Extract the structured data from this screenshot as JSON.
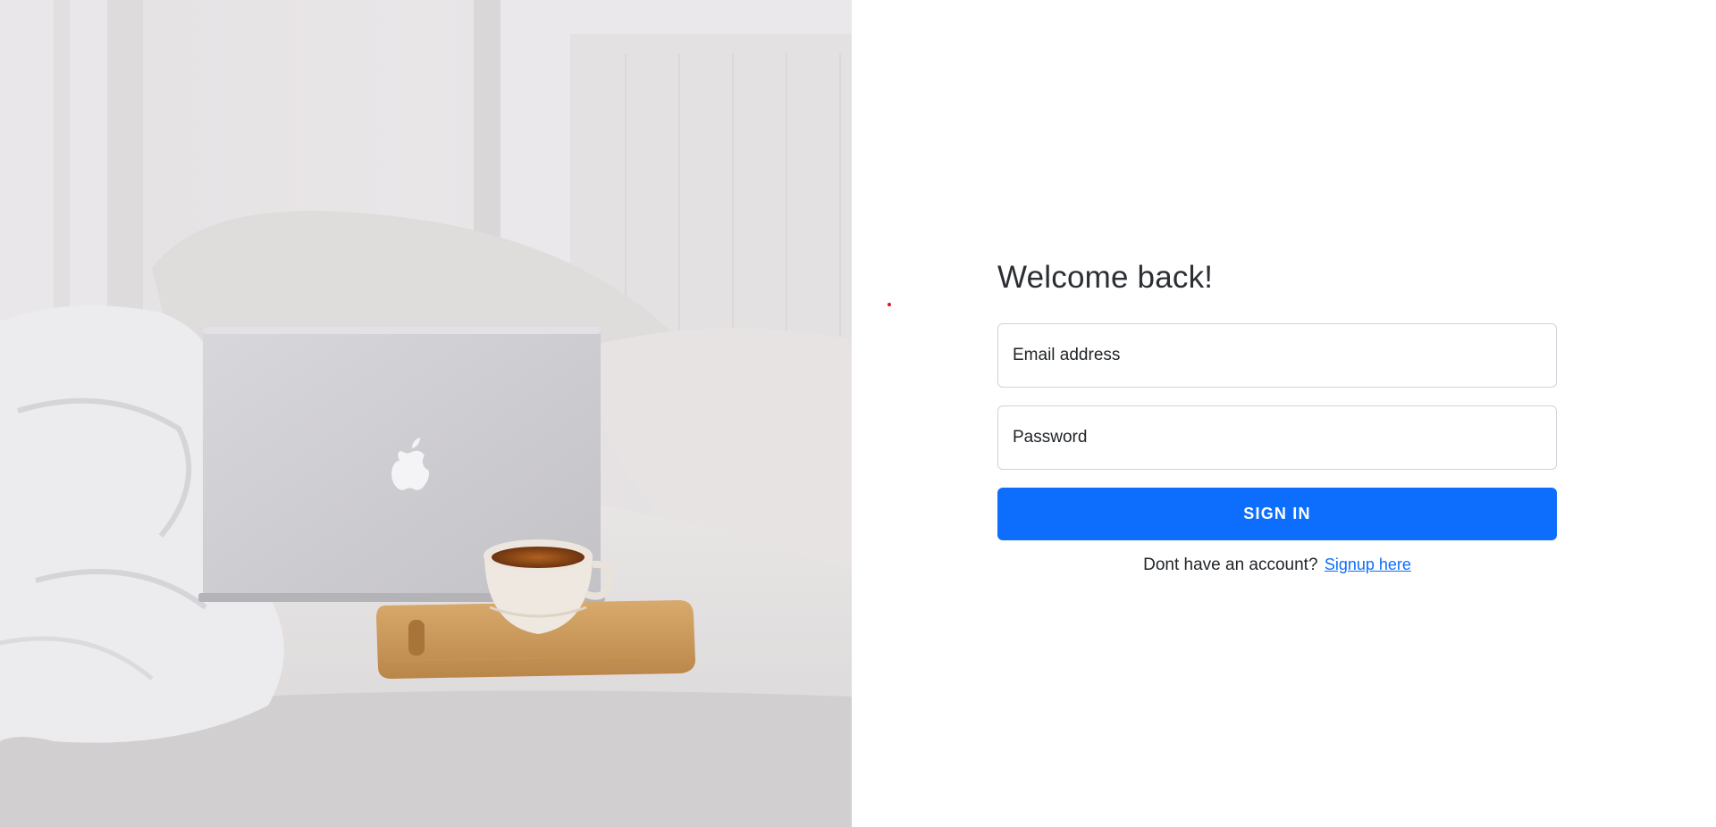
{
  "photo": {
    "alt": "Laptop and cup of coffee on a bed"
  },
  "login": {
    "title": "Welcome back!",
    "email": {
      "placeholder": "Email address",
      "value": ""
    },
    "password": {
      "placeholder": "Password",
      "value": ""
    },
    "submit_label": "SIGN IN",
    "signup_prompt": "Dont have an account?",
    "signup_link": "Signup here"
  },
  "colors": {
    "primary": "#0d6efd",
    "accent_dot": "#e0141e"
  }
}
